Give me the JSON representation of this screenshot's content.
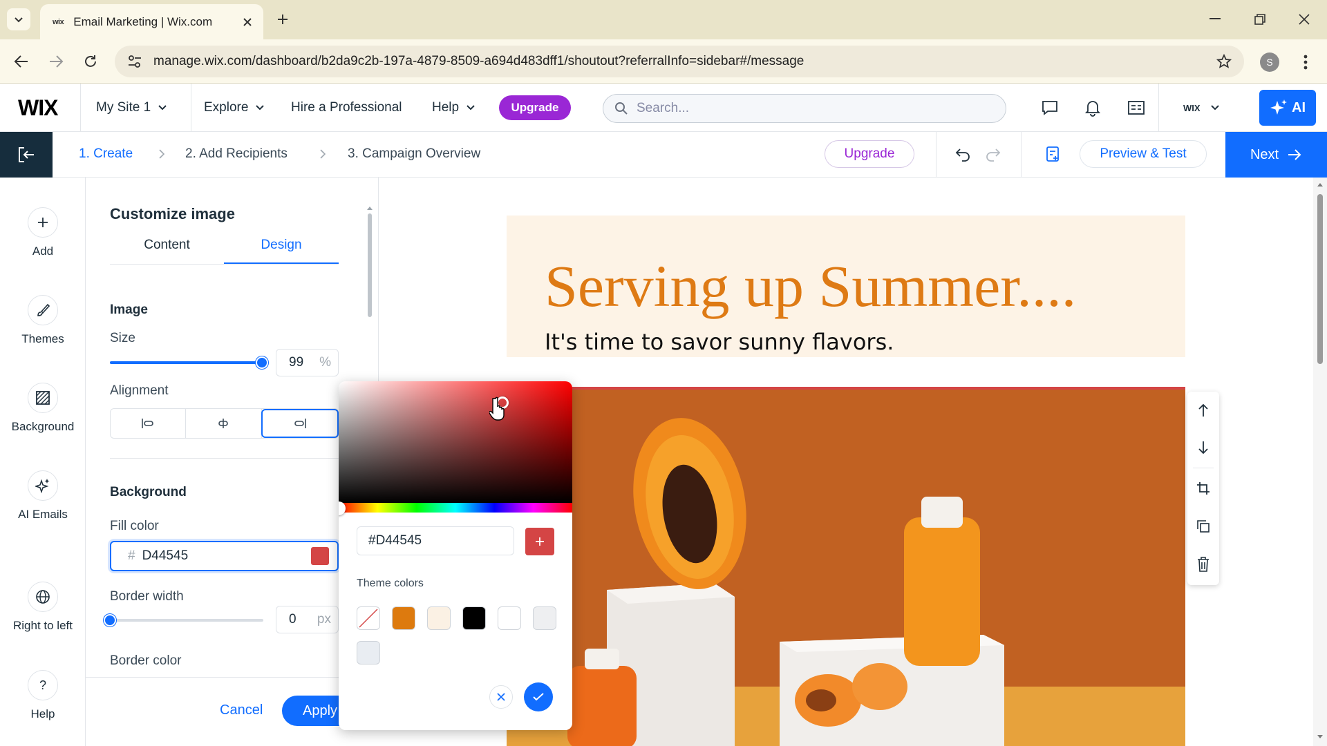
{
  "browser": {
    "tab_title": "Email Marketing | Wix.com",
    "tab_favicon": "wix",
    "url": "manage.wix.com/dashboard/b2da9c2b-197a-4879-8509-a694d483dff1/shoutout?referralInfo=sidebar#/message",
    "profile_initial": "S"
  },
  "topbar": {
    "logo": "WIX",
    "site_name": "My Site 1",
    "explore": "Explore",
    "hire": "Hire a Professional",
    "help": "Help",
    "upgrade": "Upgrade",
    "search_placeholder": "Search...",
    "account_label": "WIX",
    "ai_label": "AI"
  },
  "editor_bar": {
    "steps": [
      "1. Create",
      "2. Add Recipients",
      "3. Campaign Overview"
    ],
    "upgrade": "Upgrade",
    "preview": "Preview & Test",
    "next": "Next"
  },
  "rail": {
    "items": [
      {
        "label": "Add",
        "icon": "plus-icon"
      },
      {
        "label": "Themes",
        "icon": "brush-icon"
      },
      {
        "label": "Background",
        "icon": "background-icon"
      },
      {
        "label": "AI Emails",
        "icon": "sparkle-icon"
      },
      {
        "label": "Right to left",
        "icon": "globe-icon"
      },
      {
        "label": "Help",
        "icon": "question-icon"
      }
    ]
  },
  "panel": {
    "title": "Customize image",
    "tabs": [
      "Content",
      "Design"
    ],
    "active_tab": "Design",
    "image_heading": "Image",
    "size_label": "Size",
    "size_value": "99",
    "size_unit": "%",
    "size_fraction": 0.99,
    "alignment_label": "Alignment",
    "alignment_selected": "right",
    "background_heading": "Background",
    "fill_label": "Fill color",
    "fill_prefix": "#",
    "fill_value": "D44545",
    "border_width_label": "Border width",
    "border_width_value": "0",
    "border_width_unit": "px",
    "border_width_fraction": 0.0,
    "border_color_label": "Border color",
    "cancel": "Cancel",
    "apply": "Apply"
  },
  "color_picker": {
    "hex_value": "#D44545",
    "theme_colors_label": "Theme colors",
    "selected_color": "#D44545",
    "theme_colors": [
      "none",
      "#dd7a0e",
      "#fbf1e4",
      "#000000",
      "#ffffff",
      "#eeeff1",
      "#e9edf2"
    ]
  },
  "email": {
    "headline": "Serving up Summer....",
    "subhead": "It's time to savor sunny flavors.",
    "header_bg": "#fdf3e6",
    "headline_color": "#de7a14",
    "photo_bg": "#c96a25"
  },
  "colors": {
    "accent": "#116dff",
    "upgrade_purple": "#9a27d5",
    "fill_swatch": "#D44545"
  }
}
